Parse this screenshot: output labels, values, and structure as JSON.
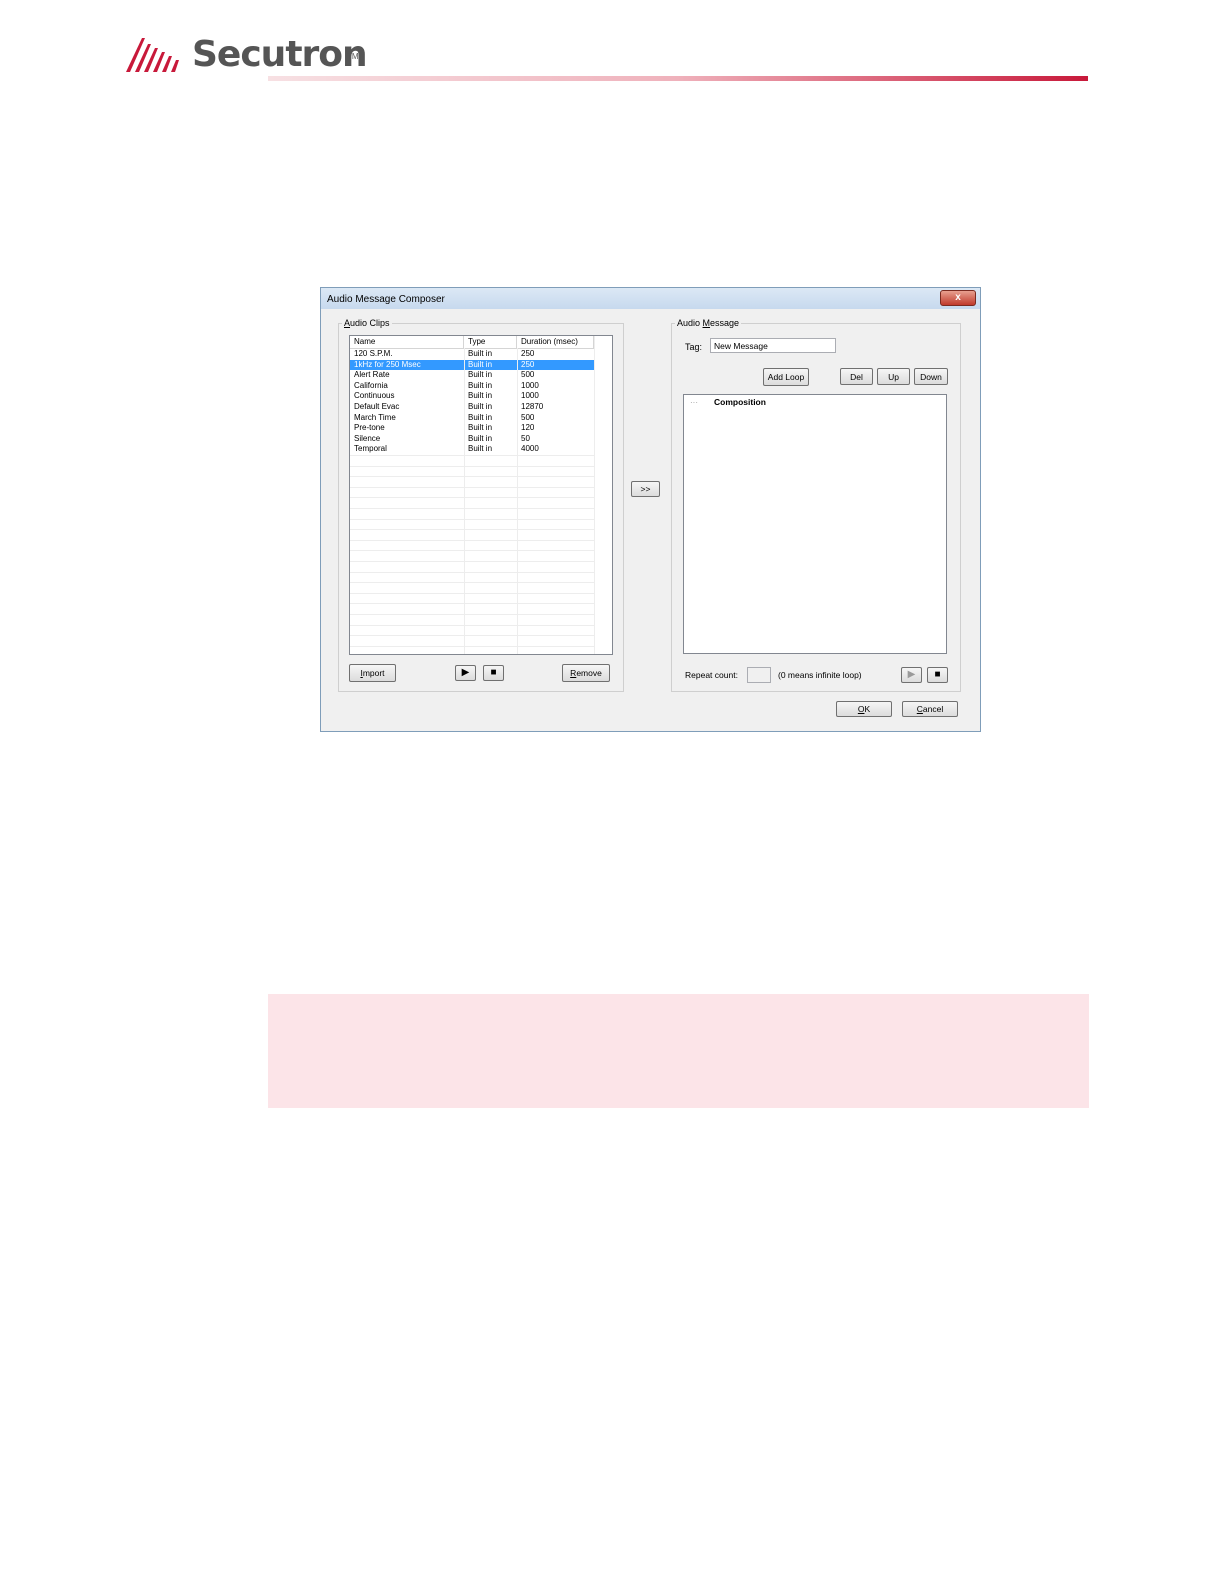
{
  "header": {
    "brand": "Secutron",
    "trademark": "TM"
  },
  "dialog": {
    "title": "Audio Message Composer",
    "close_label": "x",
    "audio_clips": {
      "legend": "Audio Clips",
      "columns": [
        "Name",
        "Type",
        "Duration (msec)"
      ],
      "rows": [
        {
          "name": "120 S.P.M.",
          "type": "Built in",
          "duration": "250"
        },
        {
          "name": "1kHz for 250 Msec",
          "type": "Built in",
          "duration": "250"
        },
        {
          "name": "Alert Rate",
          "type": "Built in",
          "duration": "500"
        },
        {
          "name": "California",
          "type": "Built in",
          "duration": "1000"
        },
        {
          "name": "Continuous",
          "type": "Built in",
          "duration": "1000"
        },
        {
          "name": "Default Evac",
          "type": "Built in",
          "duration": "12870"
        },
        {
          "name": "March Time",
          "type": "Built in",
          "duration": "500"
        },
        {
          "name": "Pre-tone",
          "type": "Built in",
          "duration": "120"
        },
        {
          "name": "Silence",
          "type": "Built in",
          "duration": "50"
        },
        {
          "name": "Temporal",
          "type": "Built in",
          "duration": "4000"
        }
      ],
      "selected_row": "1kHz for 250 Msec",
      "import_label": "Import",
      "remove_label": "Remove",
      "play_icon": "▶",
      "stop_icon": "■"
    },
    "transfer_label": ">>",
    "audio_message": {
      "legend": "Audio Message",
      "tag_label": "Tag:",
      "tag_value": "New Message",
      "add_loop_label": "Add Loop",
      "del_label": "Del",
      "up_label": "Up",
      "down_label": "Down",
      "tree_root": "Composition",
      "tree_dots": "···",
      "repeat_label": "Repeat count:",
      "repeat_hint": "(0 means infinite loop)",
      "play_icon": "▶",
      "stop_icon": "■"
    },
    "ok_label": "OK",
    "cancel_label": "Cancel"
  },
  "colors": {
    "brand_red": "#c8193a",
    "selection": "#3399ff",
    "note_background": "#fce4e8"
  }
}
